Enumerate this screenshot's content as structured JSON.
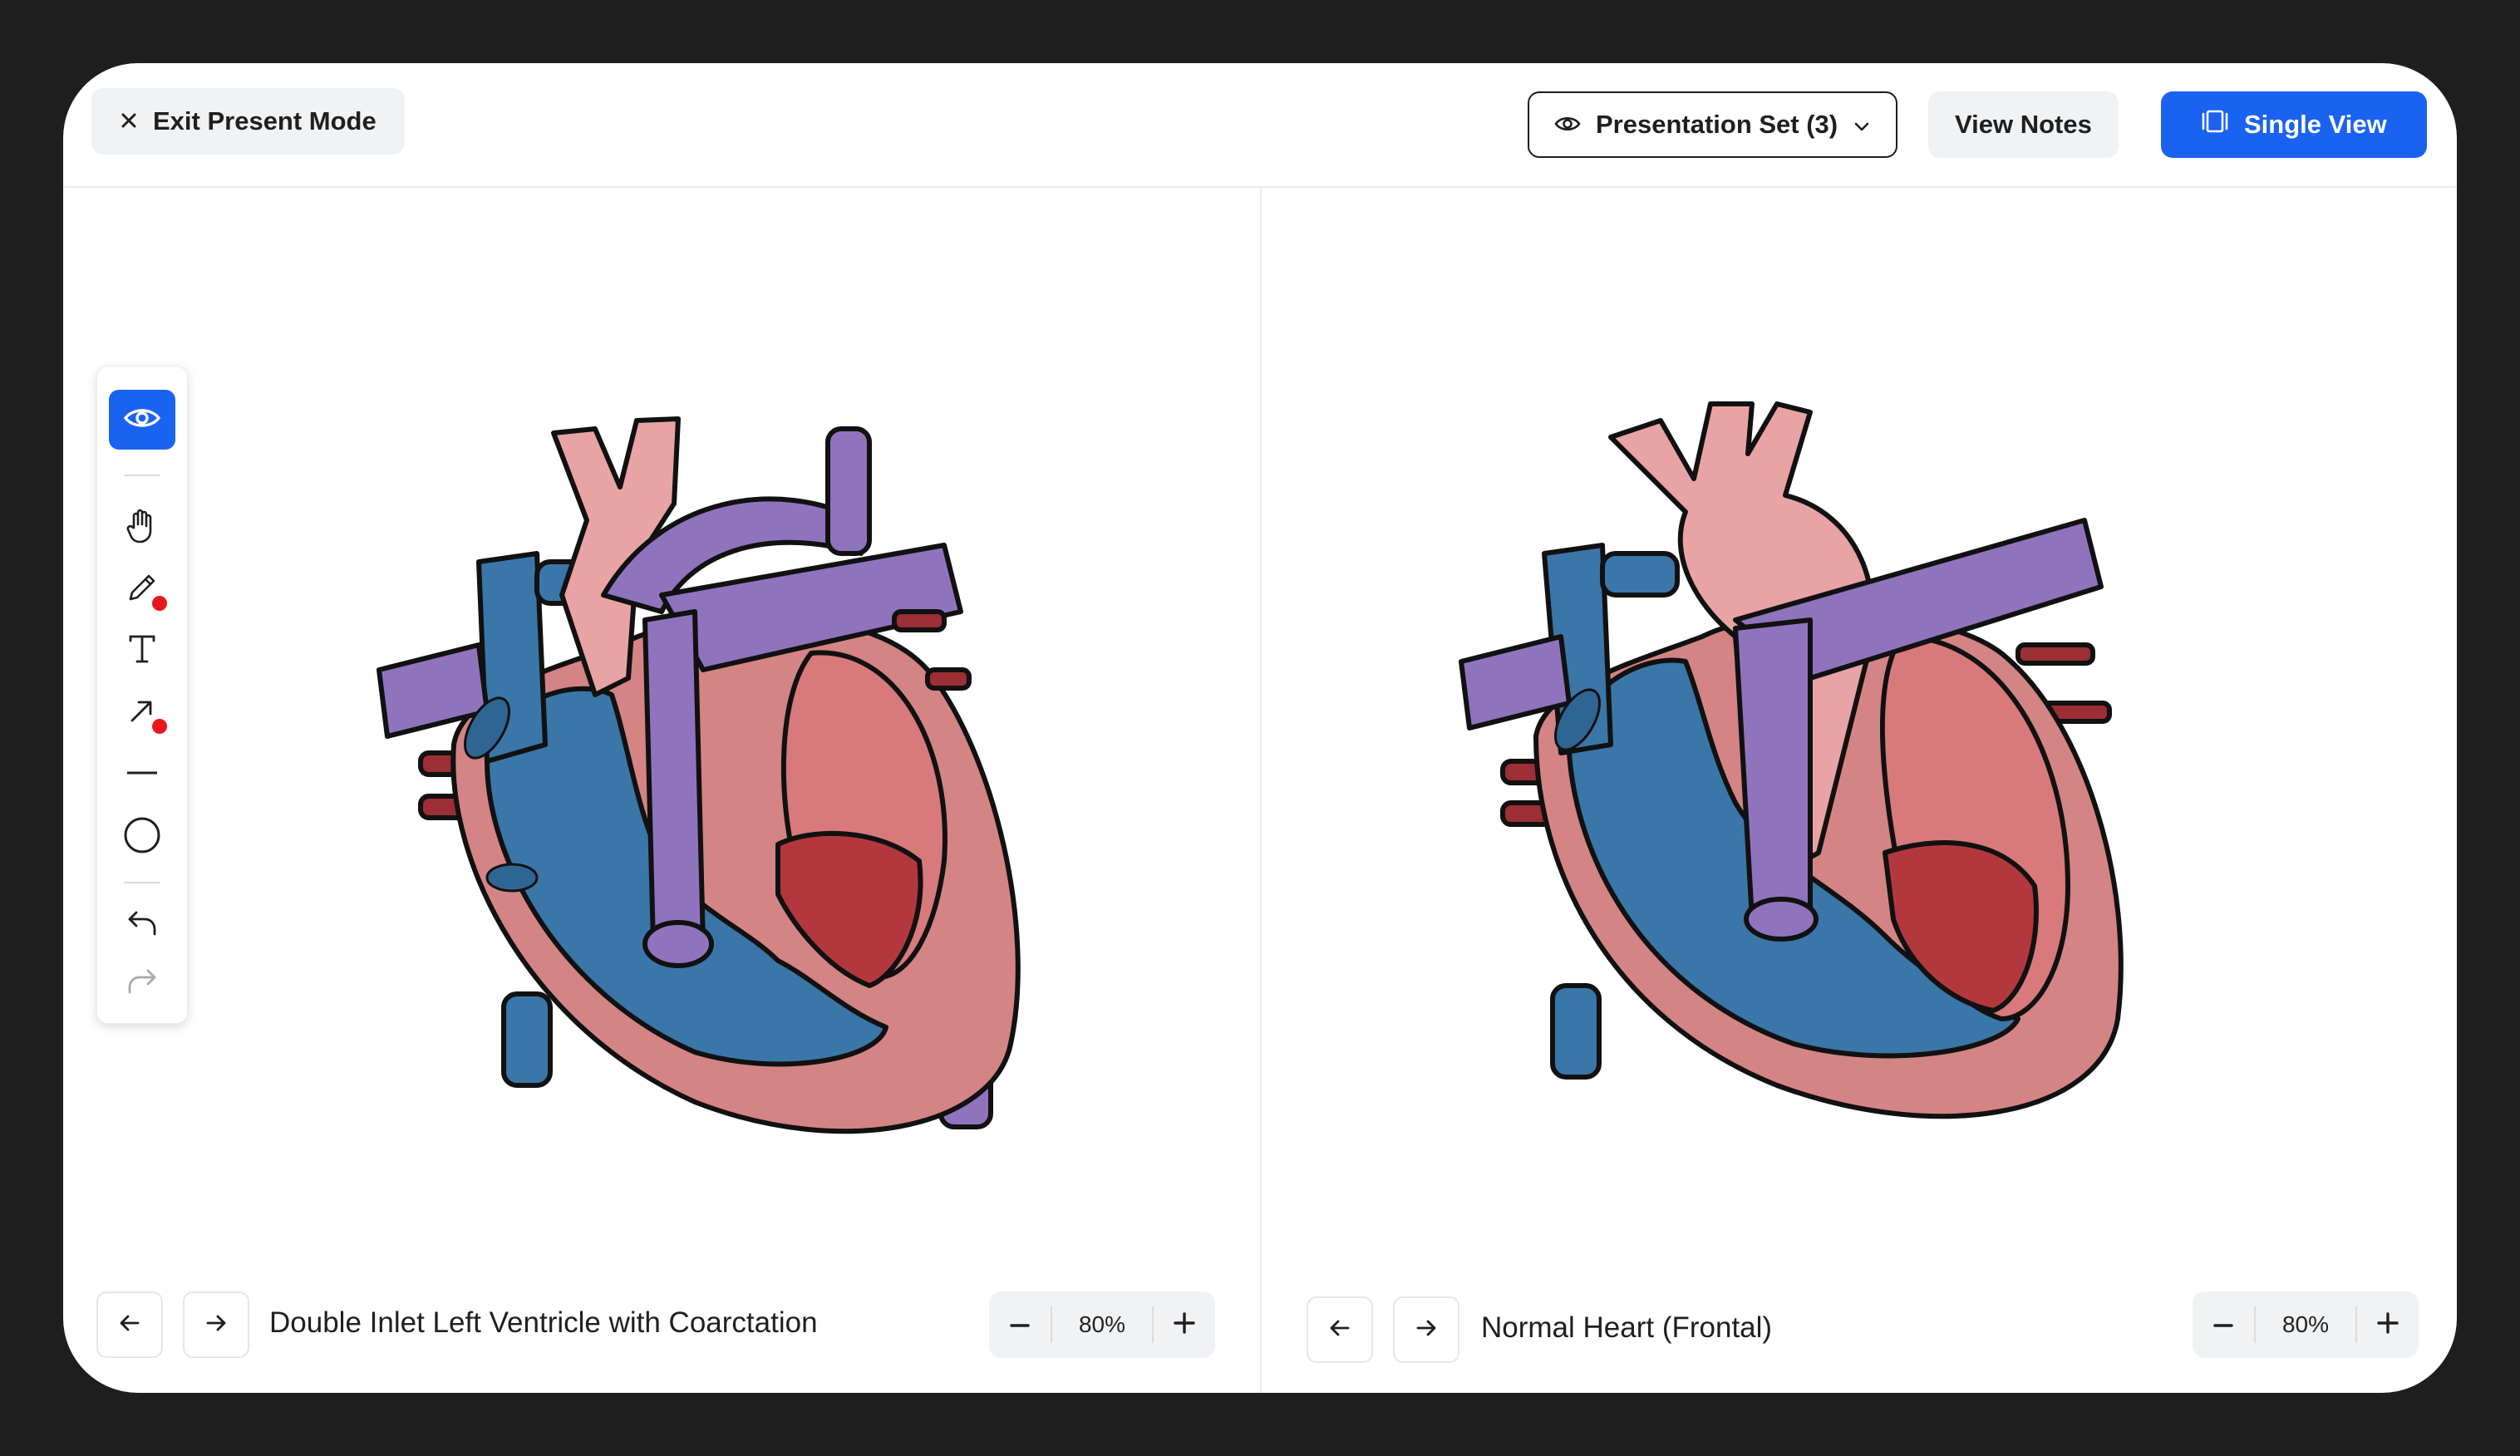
{
  "topbar": {
    "exit_label": "Exit Present Mode",
    "presentation_set_label": "Presentation Set (3)",
    "view_notes_label": "View Notes",
    "single_view_label": "Single View"
  },
  "toolbar": {
    "tools": [
      "eye-icon",
      "hand-icon",
      "pencil-icon",
      "text-icon",
      "arrow-icon",
      "line-icon",
      "circle-icon",
      "undo-icon",
      "redo-icon"
    ],
    "active_tool": "eye-icon",
    "accent_color": "#1a63f0",
    "indicator_color": "#e8171e"
  },
  "left_pane": {
    "caption": "Double Inlet Left Ventricle with Coarctation",
    "zoom": "80%"
  },
  "right_pane": {
    "caption": "Normal Heart (Frontal)",
    "zoom": "80%"
  },
  "colors": {
    "deoxygenated": "#3a76a8",
    "oxygenated": "#e8a3a4",
    "pulmonary": "#8f74bd",
    "muscle": "#d48485",
    "chamber": "#b3383d"
  }
}
